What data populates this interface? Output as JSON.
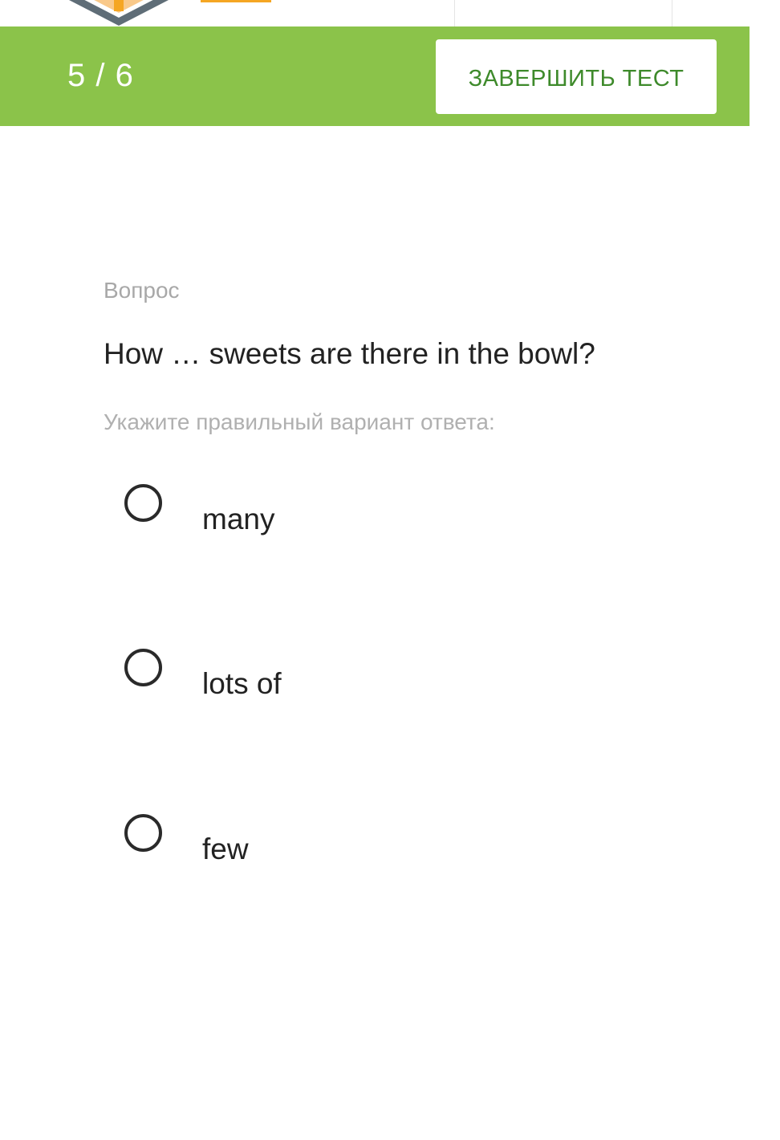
{
  "header": {
    "logo_icon": "cube-logo-icon"
  },
  "quiz_bar": {
    "progress": "5 / 6",
    "finish_button_label": "ЗАВЕРШИТЬ ТЕСТ",
    "bar_color": "#8bc34a",
    "button_text_color": "#3e8a2b"
  },
  "question": {
    "label": "Вопрос",
    "text": "How … sweets are there in the bowl?",
    "hint": "Укажите правильный вариант ответа:"
  },
  "options": [
    {
      "label": "many",
      "selected": false
    },
    {
      "label": "lots of",
      "selected": false
    },
    {
      "label": "few",
      "selected": false
    }
  ]
}
